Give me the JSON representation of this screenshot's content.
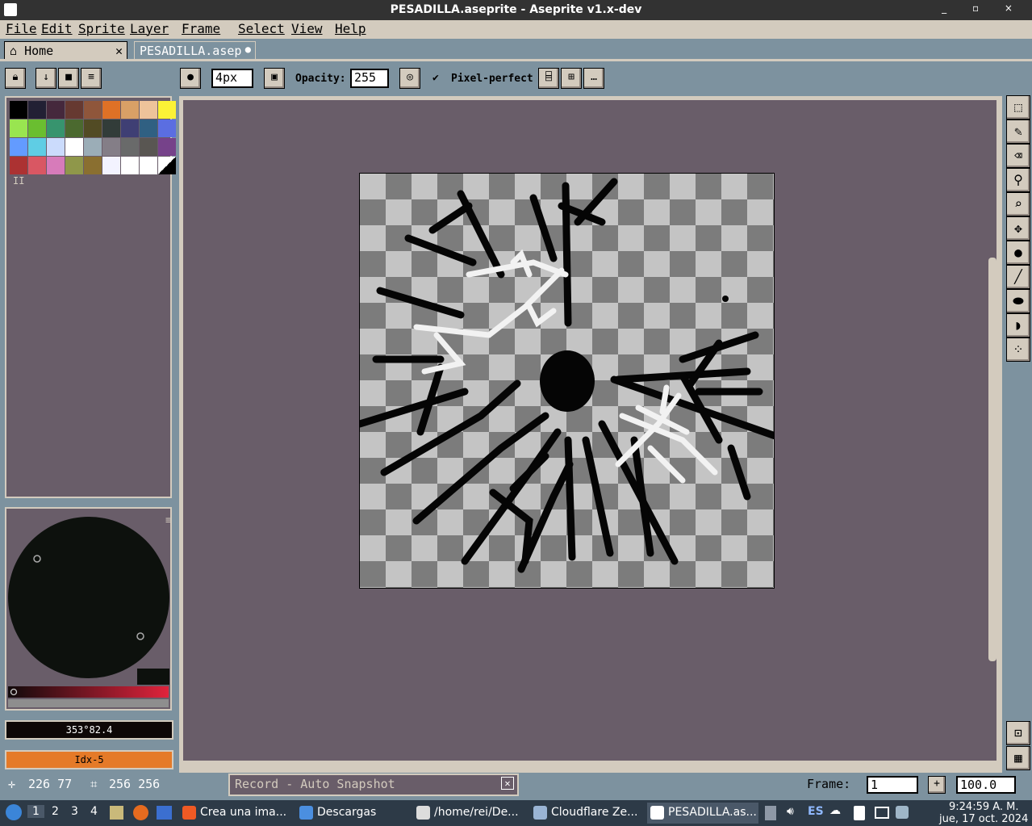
{
  "window": {
    "title": "PESADILLA.aseprite - Aseprite v1.x-dev",
    "buttons": "_ ▫ ×"
  },
  "menu": [
    "File",
    "Edit",
    "Sprite",
    "Layer",
    "Frame",
    "Select",
    "View",
    "Help"
  ],
  "tabs": {
    "home": "Home",
    "home_close": "✕",
    "active": "PESADILLA.asep",
    "active_dot": "●"
  },
  "toolbar": {
    "brush_size": "4px",
    "opacity_label": "Opacity:",
    "opacity_value": "255",
    "pixel_perfect": "Pixel-perfect",
    "pixel_perfect_check": "✔"
  },
  "palette": {
    "colors": [
      "#000000",
      "#222034",
      "#45283c",
      "#663931",
      "#8f563b",
      "#df7126",
      "#d9a066",
      "#eec39a",
      "#fbf236",
      "#99e550",
      "#6abe30",
      "#37946e",
      "#4b692f",
      "#524b24",
      "#323c39",
      "#3f3f74",
      "#306082",
      "#5b6ee1",
      "#639bff",
      "#5fcde4",
      "#cbdbfc",
      "#ffffff",
      "#9badb7",
      "#847e87",
      "#696a6a",
      "#595652",
      "#76428a",
      "#ac3232",
      "#d95763",
      "#d77bba",
      "#8f974a",
      "#8a6f30",
      "#f3f3ff",
      "#ffffff",
      "#ffffff",
      "#000000"
    ],
    "handle": "II"
  },
  "color": {
    "bg_value": "353°82.4",
    "fg_value": "Idx-5",
    "fg_color": "#e57a28",
    "bg_color": "#0e0707"
  },
  "status": {
    "cursor": "226 77",
    "size": "256 256",
    "record": "Record - Auto Snapshot",
    "frame_label": "Frame:",
    "frame_value": "1",
    "zoom": "100.0"
  },
  "tools": [
    "marquee-icon",
    "pencil-icon",
    "eraser-icon",
    "eyedropper-icon",
    "zoom-icon",
    "move-icon",
    "fill-icon",
    "line-icon",
    "ellipse-icon",
    "blur-icon",
    "spray-icon"
  ],
  "taskbar": {
    "workspaces": [
      "1",
      "2",
      "3",
      "4"
    ],
    "items": [
      "Crea una ima...",
      "Descargas",
      "/home/rei/De...",
      "Cloudflare Ze...",
      "PESADILLA.as..."
    ],
    "lang": "ES",
    "time": "9:24:59 A. M.",
    "date": "jue, 17 oct. 2024"
  }
}
